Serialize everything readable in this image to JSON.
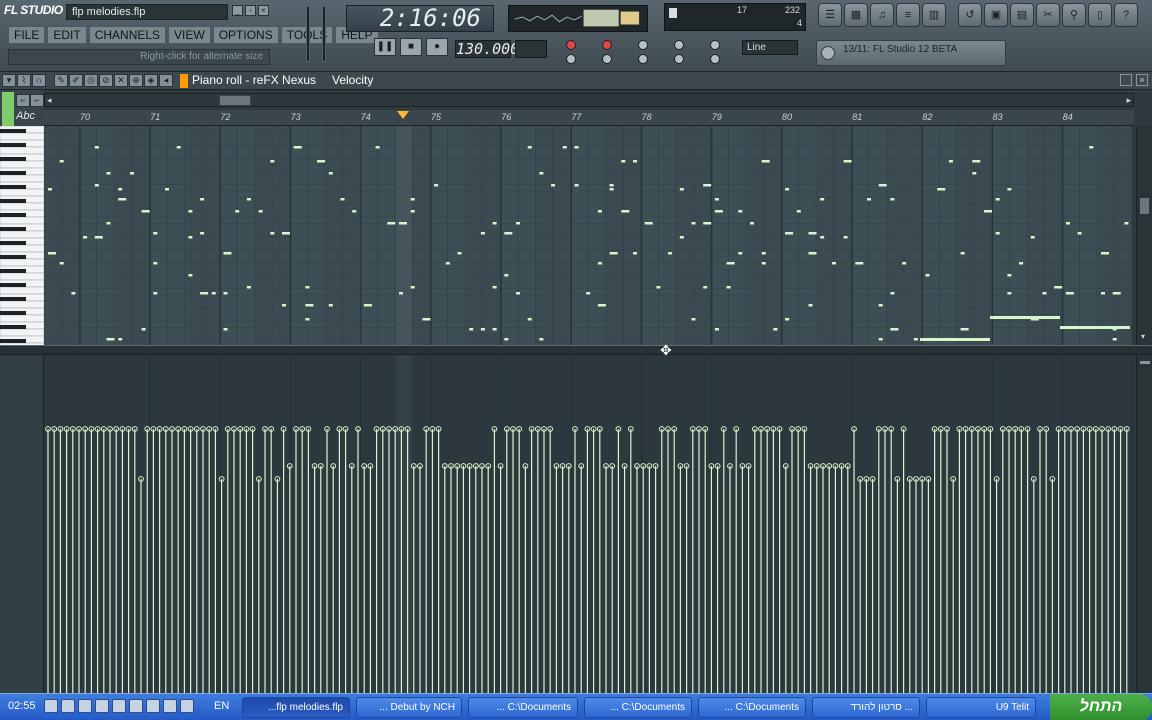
{
  "app": {
    "logo": "FL STUDIO",
    "file_name": "flp melodies.flp"
  },
  "menu": [
    "FILE",
    "EDIT",
    "CHANNELS",
    "VIEW",
    "OPTIONS",
    "TOOLS",
    "HELP"
  ],
  "hint_bar": "Right-click for alternate size",
  "song_time": "2:16:06",
  "tempo": "130.000",
  "snap": "Line",
  "hint_panel": "13/11: FL Studio 12 BETA",
  "cpu": {
    "a": "17",
    "b": "232",
    "c": "4"
  },
  "piano_roll": {
    "title": "Piano roll - reFX Nexus",
    "view": "Velocity",
    "abc": "Abc"
  },
  "ruler_ticks": [
    "70",
    "71",
    "72",
    "73",
    "74",
    "75",
    "76",
    "77",
    "78",
    "79",
    "80",
    "81",
    "82",
    "83",
    "84"
  ],
  "taskbar": {
    "clock": "02:55",
    "lang": "EN",
    "buttons": [
      "...flp melodies.flp",
      "... Debut by NCH",
      "... C:\\Documents",
      "... C:\\Documents",
      "... C:\\Documents",
      "סרטון להורד ...",
      "U9 Telit"
    ],
    "start": "התחל"
  },
  "colors": {
    "note": "#d8f5cc",
    "grid_bg": "#3c4b52",
    "velocity": "#d8f5cc",
    "accent": "#ff9a00"
  }
}
